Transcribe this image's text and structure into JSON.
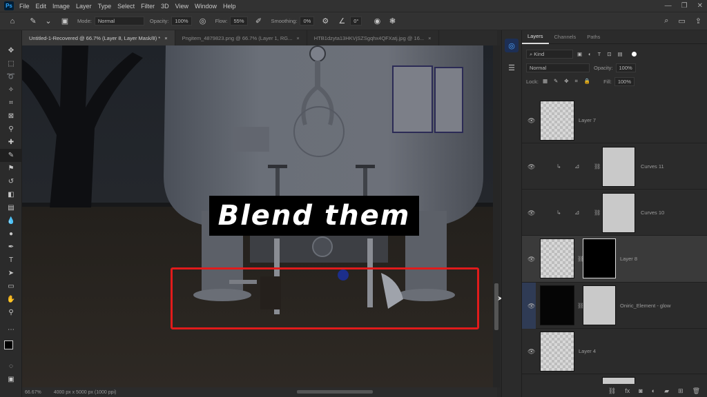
{
  "menubar": {
    "logo": "Ps",
    "items": [
      "File",
      "Edit",
      "Image",
      "Layer",
      "Type",
      "Select",
      "Filter",
      "3D",
      "View",
      "Window",
      "Help"
    ],
    "window_controls": [
      "—",
      "❐",
      "✕"
    ]
  },
  "options": {
    "mode_label": "Mode:",
    "mode_value": "Normal",
    "opacity_label": "Opacity:",
    "opacity_value": "100%",
    "flow_label": "Flow:",
    "flow_value": "55%",
    "smoothing_label": "Smoothing:",
    "smoothing_value": "0%",
    "angle_value": "0°"
  },
  "tabs": [
    {
      "label": "Untitled-1-Recovered @ 66.7% (Layer 8, Layer Mask/8) *",
      "close": "×"
    },
    {
      "label": "Pngitem_4879823.png @ 66.7% (Layer 1, RG...",
      "close": "×"
    },
    {
      "label": "HTB1dzyta13HKVjSZSgqhx4QFXatj.jpg @ 16...",
      "close": "×"
    }
  ],
  "status": {
    "zoom": "66.67%",
    "doc_size": "4000 px x 5000 px (1000 ppi)"
  },
  "caption": "Blend them",
  "layers_panel": {
    "tabs": [
      "Layers",
      "Channels",
      "Paths"
    ],
    "kind_label": "Kind",
    "blend_mode": "Normal",
    "opacity_label": "Opacity:",
    "opacity_value": "100%",
    "lock_label": "Lock:",
    "fill_label": "Fill:",
    "fill_value": "100%",
    "layers": [
      {
        "name": "Layer 7"
      },
      {
        "name": "Curves 11"
      },
      {
        "name": "Curves 10"
      },
      {
        "name": "Layer 8"
      },
      {
        "name": "Oniric_Element - glow"
      },
      {
        "name": "Layer 4"
      }
    ]
  },
  "colors": {
    "highlight": "#e11b1b",
    "caption_bg": "#000000",
    "caption_text": "#ffffff"
  }
}
